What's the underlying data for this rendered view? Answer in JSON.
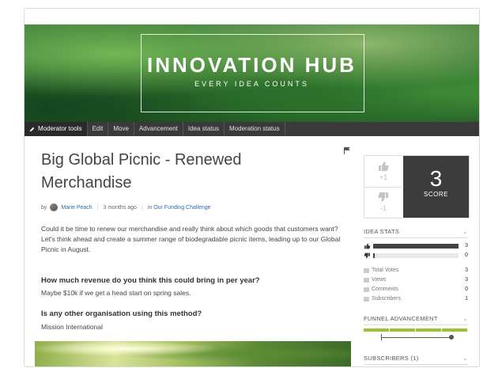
{
  "hero": {
    "title": "INNOVATION HUB",
    "subtitle": "EVERY IDEA COUNTS"
  },
  "modbar": {
    "items": [
      "Moderator tools",
      "Edit",
      "Move",
      "Advancement",
      "Idea status",
      "Moderation status"
    ]
  },
  "idea": {
    "title": "Big Global Picnic - Renewed Merchandise",
    "by_label": "by",
    "author": "Marie Peach",
    "time": "3 months ago",
    "in_label": "in",
    "challenge": "Our Funding Challenge",
    "description": "Could it be time to renew our merchandise and really think about which goods that customers want? Let's think ahead and create a summer range of biodegradable picnic items, leading up to our Global Picnic in August.",
    "questions": [
      {
        "q": "How much revenue do you think this could bring in per year?",
        "a": "Maybe $10k if we get a head start on spring sales."
      },
      {
        "q": "Is any other organisation using this method?",
        "a": "Mission International"
      }
    ]
  },
  "vote": {
    "up_label": "+1",
    "down_label": "-1",
    "score": "3",
    "score_label": "SCORE"
  },
  "idea_stats": {
    "heading": "IDEA STATS",
    "up_votes": 3,
    "down_votes": 0,
    "up_fraction": 1.0,
    "down_fraction": 0.02,
    "rows": [
      {
        "label": "Total Votes",
        "value": "3"
      },
      {
        "label": "Views",
        "value": "3"
      },
      {
        "label": "Comments",
        "value": "0"
      },
      {
        "label": "Subscribers",
        "value": "1"
      }
    ]
  },
  "funnel": {
    "heading": "FUNNEL ADVANCEMENT",
    "stages": 4,
    "progress_fraction": 1.0
  },
  "subscribers": {
    "heading": "SUBSCRIBERS (1)"
  },
  "colors": {
    "modbar_bg": "#3a3a3a",
    "score_bg": "#3c3c3c",
    "funnel_green": "#9cc233",
    "link": "#2b6cb0"
  },
  "icons": {
    "flag": "flag-icon",
    "pencil": "pencil-icon",
    "up": "thumbs-up-icon",
    "down": "thumbs-down-icon",
    "chevron": "chevron-down-icon"
  }
}
